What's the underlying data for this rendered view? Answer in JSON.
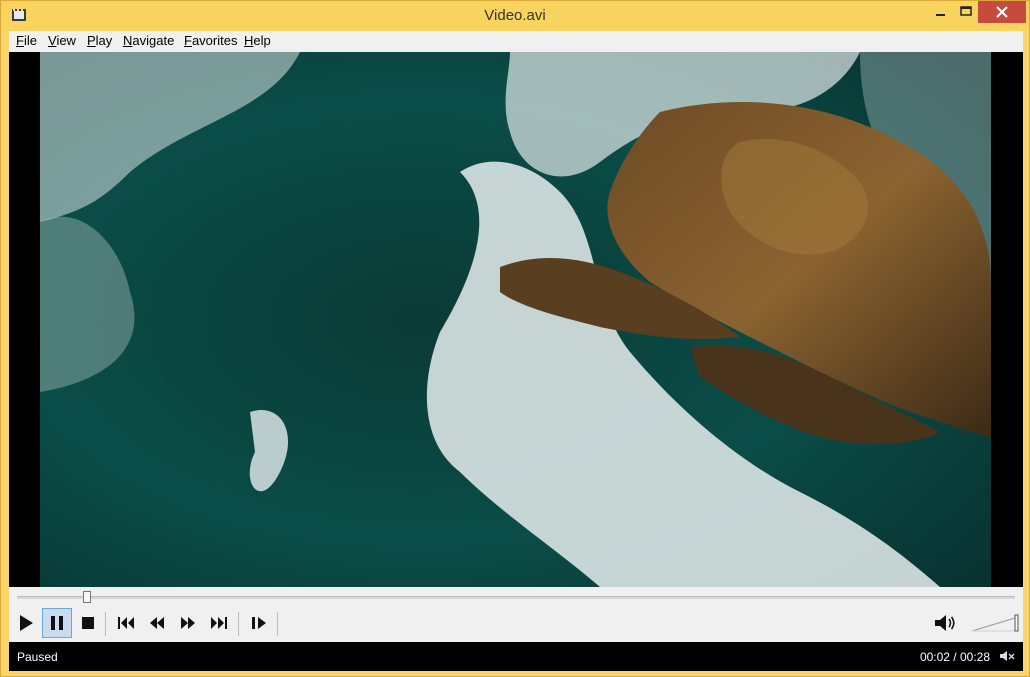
{
  "window": {
    "title": "Video.avi"
  },
  "menu": [
    "File",
    "View",
    "Play",
    "Navigate",
    "Favorites",
    "Help"
  ],
  "player": {
    "progress": 0.07
  },
  "status": {
    "state": "Paused",
    "time": "00:02 / 00:28"
  },
  "icons": {
    "app": "video-app-icon",
    "min": "minimize-icon",
    "max": "maximize-icon",
    "close": "close-icon",
    "play": "play-icon",
    "pause": "pause-icon",
    "stop": "stop-icon",
    "prev": "previous-icon",
    "rewind": "rewind-icon",
    "forward": "fast-forward-icon",
    "next": "next-icon",
    "frame_step": "frame-step-icon",
    "volume": "volume-icon",
    "mute": "mute-icon"
  }
}
